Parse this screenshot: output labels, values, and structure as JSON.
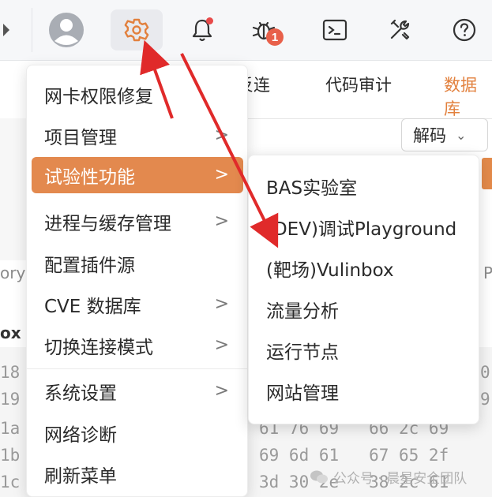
{
  "toolbar": {
    "icons": [
      "back-arrow-icon",
      "user-avatar-icon",
      "gear-icon",
      "bell-icon",
      "bug-icon",
      "terminal-icon",
      "tools-icon",
      "help-icon"
    ],
    "bug_badge": "1",
    "accent": "#e2803d"
  },
  "workspace": {
    "tabs": [
      "反连",
      "代码审计",
      "数据库"
    ],
    "decode_label": "解码",
    "side_text_left": "ory",
    "side_text_right": "P",
    "box_label": "ox",
    "hex_rows": [
      {
        "addr": "18",
        "right": "0"
      },
      {
        "addr": "19",
        "right": "9"
      },
      {
        "addr": "1a",
        "right": "61 76 69   66 2c 69"
      },
      {
        "addr": "1b",
        "right": "69 6d 61   67 65 2f"
      },
      {
        "addr": "1c",
        "right": "3d 30 2e   38 2c 61"
      }
    ]
  },
  "menu": {
    "items": [
      {
        "label": "网卡权限修复",
        "submenu": false
      },
      {
        "label": "项目管理",
        "submenu": true
      },
      {
        "label": "试验性功能",
        "submenu": true,
        "highlight": true
      },
      {
        "label": "进程与缓存管理",
        "submenu": true
      },
      {
        "label": "配置插件源",
        "submenu": false
      },
      {
        "label": "CVE 数据库",
        "submenu": true
      },
      {
        "label": "切换连接模式",
        "submenu": true
      },
      {
        "label": "系统设置",
        "submenu": true
      },
      {
        "label": "网络诊断",
        "submenu": false
      },
      {
        "label": "刷新菜单",
        "submenu": false
      }
    ],
    "highlight_color": "#e3894e"
  },
  "submenu": {
    "items": [
      "BAS实验室",
      "(DEV)调试Playground",
      "(靶场)Vulinbox",
      "流量分析",
      "运行节点",
      "网站管理"
    ]
  },
  "watermark": "公众号 · 晨星安全团队",
  "annotation_color": "#e02a2a"
}
